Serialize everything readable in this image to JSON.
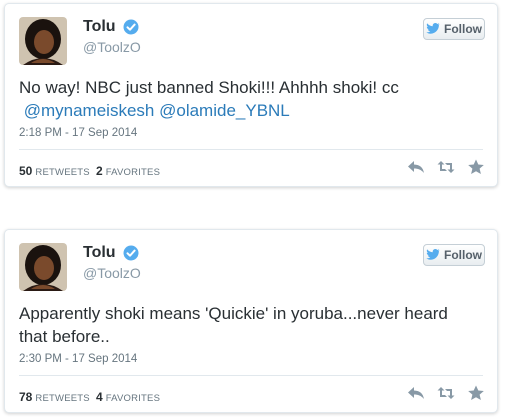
{
  "tweets": [
    {
      "name": "Tolu",
      "handle": "@ToolzO",
      "follow_label": "Follow",
      "text_plain": "No way! NBC just banned Shoki!!! Ahhhh shoki! cc",
      "mention1": "@mynameiskesh",
      "mention2": "@olamide_YBNL",
      "time": "2:18 PM - 17 Sep 2014",
      "retweets": "50",
      "retweets_label": "RETWEETS",
      "favorites": "2",
      "favorites_label": "FAVORITES"
    },
    {
      "name": "Tolu",
      "handle": "@ToolzO",
      "follow_label": "Follow",
      "text_line1": "Apparently shoki means 'Quickie' in yoruba...never heard",
      "text_line2": "that before..",
      "time": "2:30 PM - 17 Sep 2014",
      "retweets": "78",
      "retweets_label": "RETWEETS",
      "favorites": "4",
      "favorites_label": "FAVORITES"
    }
  ],
  "icons": {
    "verified": "verified-badge-icon",
    "twitter": "twitter-bird-icon",
    "reply": "reply-icon",
    "retweet": "retweet-icon",
    "favorite": "star-icon"
  },
  "colors": {
    "link": "#2b7bb9",
    "verified": "#55acee",
    "text": "#292f33",
    "muted": "#8899a6"
  }
}
